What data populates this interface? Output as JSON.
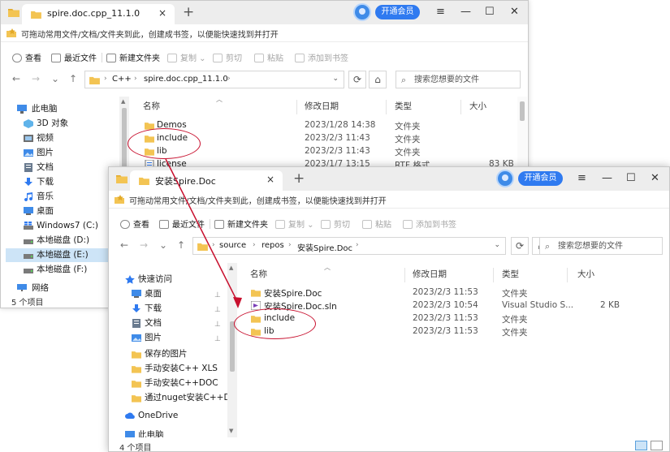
{
  "colors": {
    "folder": "#f3c453",
    "accent": "#2f7af0",
    "selected": "#cde4f7",
    "annotation": "#c8102e"
  },
  "w1": {
    "tab_title": "spire.doc.cpp_11.1.0",
    "tab_close": "×",
    "newtab": "+",
    "vip": "开通会员",
    "ctl": {
      "menu": "≡",
      "min": "—",
      "max": "☐",
      "close": "✕"
    },
    "hint": "可拖动常用文件/文档/文件夹到此，创建成书签，以便能快速找到并打开",
    "toolbar": {
      "view": "查看",
      "recent": "最近文件",
      "newfolder": "新建文件夹",
      "copy": "复制",
      "cut": "剪切",
      "paste": "粘贴",
      "bookmark": "添加到书签"
    },
    "nav": {
      "back": "←",
      "forward": "→",
      "recent": "⌄",
      "up": "↑",
      "refresh": "⟳",
      "home": "⌂",
      "dropdown": "⌄"
    },
    "path": [
      "C++",
      "spire.doc.cpp_11.1.0"
    ],
    "chev": "›",
    "search_placeholder": "搜索您想要的文件",
    "sidebar": [
      "此电脑",
      "3D 对象",
      "视频",
      "图片",
      "文档",
      "下载",
      "音乐",
      "桌面",
      "Windows7 (C:)",
      "本地磁盘 (D:)",
      "本地磁盘 (E:)",
      "本地磁盘 (F:)",
      "网络"
    ],
    "columns": {
      "name": "名称",
      "date": "修改日期",
      "type": "类型",
      "size": "大小"
    },
    "files": [
      {
        "name": "Demos",
        "date": "2023/1/28 14:38",
        "type": "文件夹",
        "size": ""
      },
      {
        "name": "include",
        "date": "2023/2/3 11:43",
        "type": "文件夹",
        "size": ""
      },
      {
        "name": "lib",
        "date": "2023/2/3 11:43",
        "type": "文件夹",
        "size": ""
      },
      {
        "name": "license",
        "date": "2023/1/7 13:15",
        "type": "RTF 格式",
        "size": "83 KB"
      }
    ],
    "status": "5 个项目"
  },
  "w2": {
    "tab_title": "安装Spire.Doc",
    "tab_close": "×",
    "newtab": "+",
    "vip": "开通会员",
    "ctl": {
      "menu": "≡",
      "min": "—",
      "max": "☐",
      "close": "✕"
    },
    "hint": "可拖动常用文件/文档/文件夹到此，创建成书签，以便能快速找到并打开",
    "toolbar": {
      "view": "查看",
      "recent": "最近文件",
      "newfolder": "新建文件夹",
      "copy": "复制",
      "cut": "剪切",
      "paste": "粘贴",
      "bookmark": "添加到书签"
    },
    "nav": {
      "back": "←",
      "forward": "→",
      "recent": "⌄",
      "up": "↑",
      "refresh": "⟳",
      "home": "⌂",
      "dropdown": "⌄"
    },
    "path": [
      "source",
      "repos",
      "安装Spire.Doc"
    ],
    "chev": "›",
    "search_placeholder": "搜索您想要的文件",
    "sidebar": [
      "快速访问",
      "桌面",
      "下载",
      "文档",
      "图片",
      "保存的图片",
      "手动安装C++ XLS",
      "手动安装C++DOC",
      "通过nuget安装C++DOC",
      "OneDrive",
      "此电脑"
    ],
    "pin": "📌",
    "columns": {
      "name": "名称",
      "date": "修改日期",
      "type": "类型",
      "size": "大小"
    },
    "files": [
      {
        "name": "安装Spire.Doc",
        "date": "2023/2/3 11:53",
        "type": "文件夹",
        "size": ""
      },
      {
        "name": "安装Spire.Doc.sln",
        "date": "2023/2/3 10:54",
        "type": "Visual Studio S...",
        "size": "2 KB"
      },
      {
        "name": "include",
        "date": "2023/2/3 11:53",
        "type": "文件夹",
        "size": ""
      },
      {
        "name": "lib",
        "date": "2023/2/3 11:53",
        "type": "文件夹",
        "size": ""
      }
    ],
    "status": "4 个项目"
  }
}
